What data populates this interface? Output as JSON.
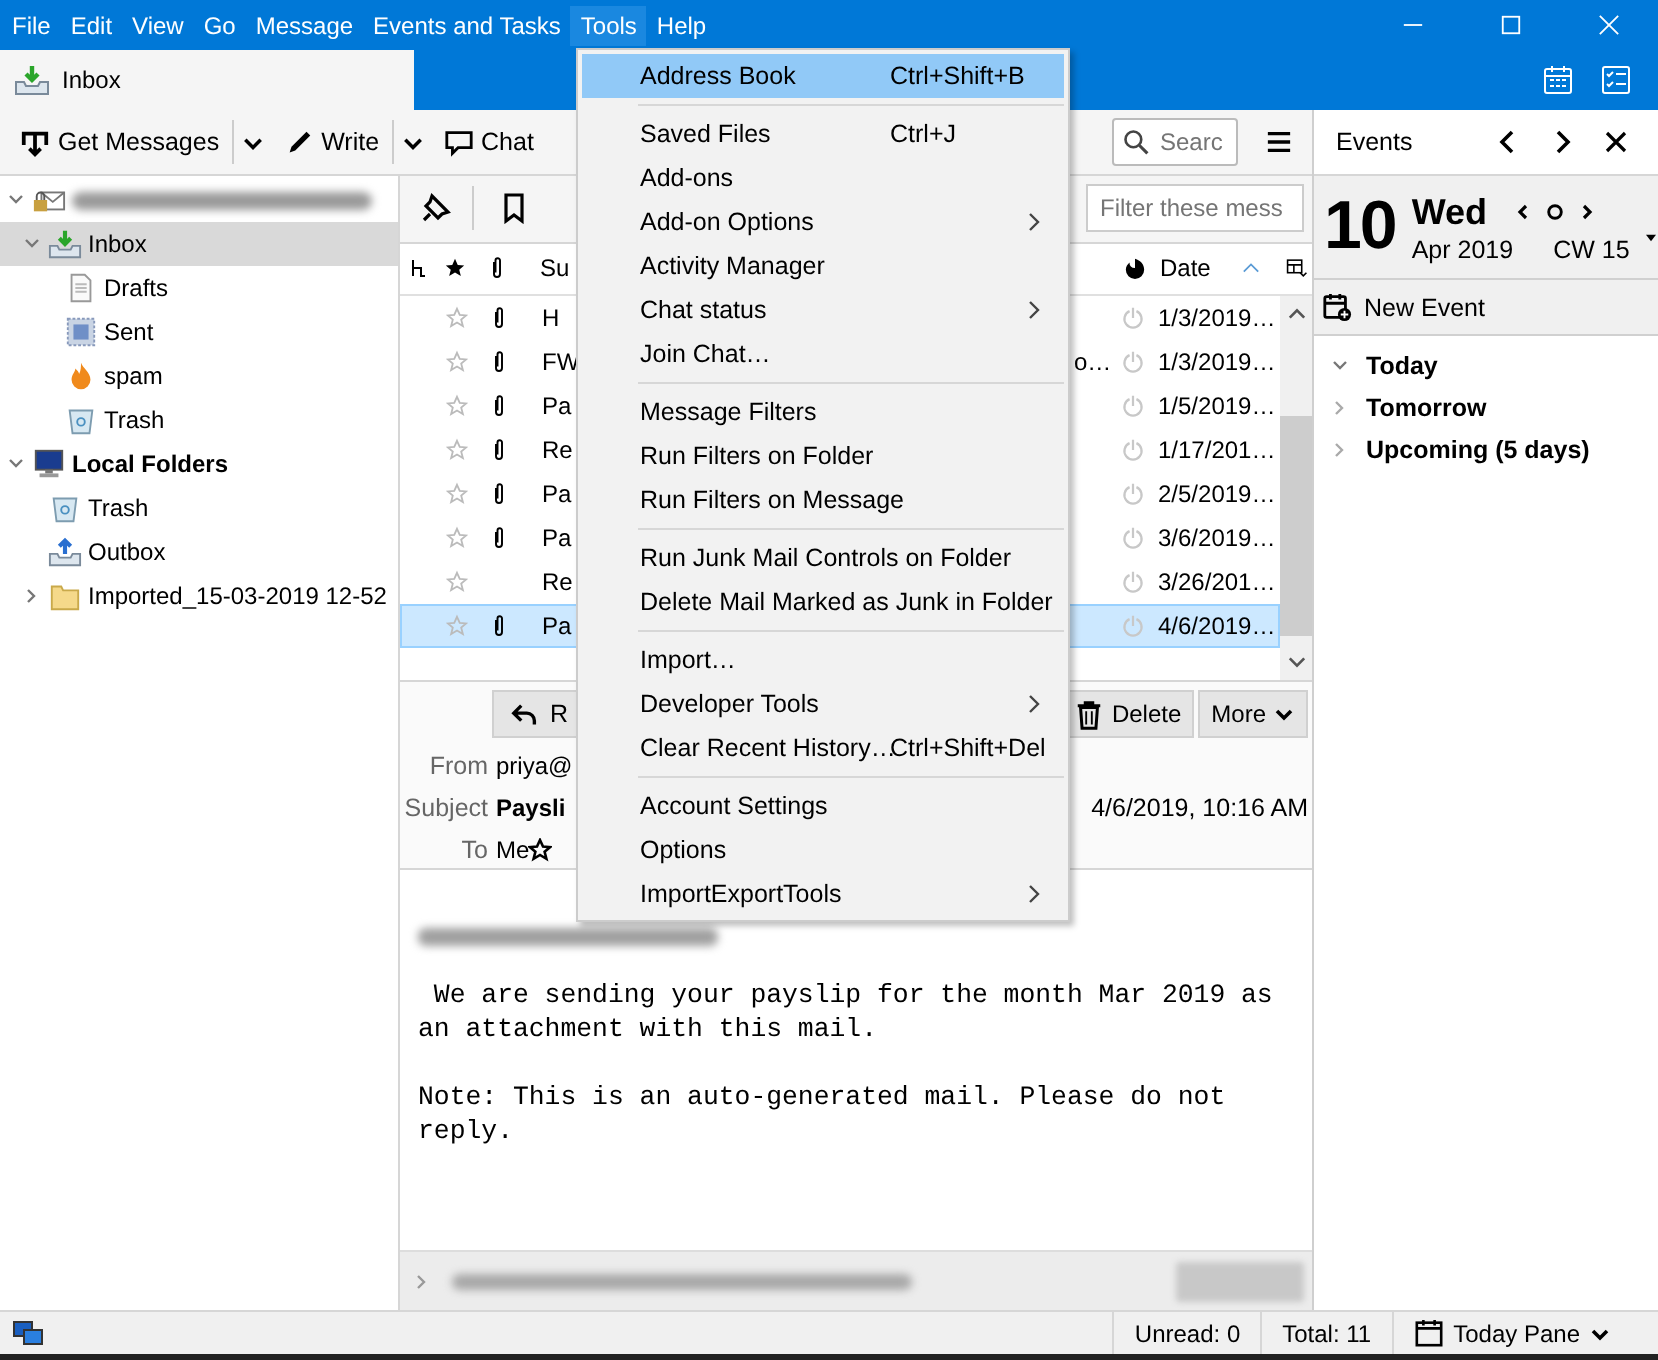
{
  "menubar": [
    {
      "label": "File",
      "selected": false
    },
    {
      "label": "Edit",
      "selected": false
    },
    {
      "label": "View",
      "selected": false
    },
    {
      "label": "Go",
      "selected": false
    },
    {
      "label": "Message",
      "selected": false
    },
    {
      "label": "Events and Tasks",
      "selected": false
    },
    {
      "label": "Tools",
      "selected": true
    },
    {
      "label": "Help",
      "selected": false
    }
  ],
  "tabs": [
    {
      "label": "Inbox",
      "selected": true
    }
  ],
  "toolbar": {
    "buttons": [
      {
        "kind": "get",
        "label": "Get Messages",
        "dropdown": true
      },
      {
        "kind": "write",
        "label": "Write",
        "dropdown": true
      },
      {
        "kind": "chat",
        "label": "Chat",
        "dropdown": false
      }
    ],
    "search": {
      "placeholder": "Searc"
    }
  },
  "folders": [
    {
      "kind": "account",
      "expanded": true,
      "selected": false,
      "children": [
        {
          "kind": "inbox",
          "label": "Inbox",
          "expanded": true,
          "selected": true,
          "children": [
            {
              "kind": "drafts",
              "label": "Drafts",
              "selected": false
            },
            {
              "kind": "sent",
              "label": "Sent",
              "selected": false
            },
            {
              "kind": "spam",
              "label": "spam",
              "selected": false
            },
            {
              "kind": "trash",
              "label": "Trash",
              "selected": false
            }
          ]
        }
      ]
    },
    {
      "kind": "local",
      "label": "Local Folders",
      "expanded": true,
      "selected": false,
      "children": [
        {
          "kind": "trash",
          "label": "Trash",
          "selected": false
        },
        {
          "kind": "outbox",
          "label": "Outbox",
          "selected": false
        },
        {
          "kind": "folder",
          "label": "Imported_15-03-2019 12-52",
          "expanded": false,
          "selected": false
        }
      ]
    }
  ],
  "quick_filter": {
    "placeholder": "Filter these mess"
  },
  "message_list": {
    "columns": {
      "subject": "Su",
      "date": "Date"
    },
    "rows": [
      {
        "starred": false,
        "attachment": true,
        "subject": "H",
        "date": "1/3/2019…",
        "selected": false
      },
      {
        "starred": false,
        "attachment": true,
        "subject": "FW",
        "column_4": "o…",
        "date": "1/3/2019…",
        "selected": false
      },
      {
        "starred": false,
        "attachment": true,
        "subject": "Pa",
        "date": "1/5/2019…",
        "selected": false
      },
      {
        "starred": false,
        "attachment": true,
        "subject": "Re",
        "date": "1/17/201…",
        "selected": false
      },
      {
        "starred": false,
        "attachment": true,
        "subject": "Pa",
        "date": "2/5/2019…",
        "selected": false
      },
      {
        "starred": false,
        "attachment": true,
        "subject": "Pa",
        "date": "3/6/2019…",
        "selected": false
      },
      {
        "starred": false,
        "attachment": false,
        "subject": "Re",
        "date": "3/26/201…",
        "selected": false
      },
      {
        "starred": false,
        "attachment": true,
        "subject": "Pa",
        "date": "4/6/2019…",
        "selected": true
      }
    ]
  },
  "message_header": {
    "buttons": [
      {
        "kind": "reply",
        "label": "R"
      },
      {
        "kind": "delete",
        "label": "Delete"
      },
      {
        "kind": "more",
        "label": "More"
      }
    ],
    "fields": [
      {
        "label": "From",
        "value": "priya@"
      },
      {
        "label": "Subject",
        "value": "Paysli",
        "date": "4/6/2019, 10:16 AM"
      },
      {
        "label": "To",
        "value": "Me"
      }
    ]
  },
  "body": {
    "paragraphs": [
      " We are sending your payslip for the month Mar 2019 as\nan attachment with this mail.",
      "Note: This is an auto-generated mail. Please do not\nreply."
    ]
  },
  "events": {
    "title": "Events",
    "day": "10",
    "weekday": "Wed",
    "month_year": "Apr 2019",
    "week": "CW 15",
    "new_event": "New Event",
    "sections": [
      {
        "label": "Today",
        "expanded": true
      },
      {
        "label": "Tomorrow",
        "expanded": false
      },
      {
        "label": "Upcoming (5 days)",
        "expanded": false
      }
    ]
  },
  "status_bar": {
    "unread": "Unread: 0",
    "total": "Total: 11",
    "today_pane": "Today Pane"
  },
  "tools_menu": {
    "items": [
      {
        "kind": "item",
        "label": "Address Book",
        "shortcut": "Ctrl+Shift+B",
        "submenu": false,
        "selected": true
      },
      {
        "kind": "separator"
      },
      {
        "kind": "item",
        "label": "Saved Files",
        "shortcut": "Ctrl+J",
        "submenu": false,
        "selected": false
      },
      {
        "kind": "item",
        "label": "Add-ons",
        "submenu": false,
        "selected": false
      },
      {
        "kind": "item",
        "label": "Add-on Options",
        "submenu": true,
        "selected": false
      },
      {
        "kind": "item",
        "label": "Activity Manager",
        "submenu": false,
        "selected": false
      },
      {
        "kind": "item",
        "label": "Chat status",
        "submenu": true,
        "selected": false
      },
      {
        "kind": "item",
        "label": "Join Chat…",
        "submenu": false,
        "selected": false
      },
      {
        "kind": "separator"
      },
      {
        "kind": "item",
        "label": "Message Filters",
        "submenu": false,
        "selected": false
      },
      {
        "kind": "item",
        "label": "Run Filters on Folder",
        "submenu": false,
        "selected": false
      },
      {
        "kind": "item",
        "label": "Run Filters on Message",
        "submenu": false,
        "selected": false
      },
      {
        "kind": "separator"
      },
      {
        "kind": "item",
        "label": "Run Junk Mail Controls on Folder",
        "submenu": false,
        "selected": false
      },
      {
        "kind": "item",
        "label": "Delete Mail Marked as Junk in Folder",
        "submenu": false,
        "selected": false
      },
      {
        "kind": "separator"
      },
      {
        "kind": "item",
        "label": "Import…",
        "submenu": false,
        "selected": false
      },
      {
        "kind": "item",
        "label": "Developer Tools",
        "submenu": true,
        "selected": false
      },
      {
        "kind": "item",
        "label": "Clear Recent History…",
        "shortcut": "Ctrl+Shift+Del",
        "submenu": false,
        "selected": false
      },
      {
        "kind": "separator"
      },
      {
        "kind": "item",
        "label": "Account Settings",
        "submenu": false,
        "selected": false
      },
      {
        "kind": "item",
        "label": "Options",
        "submenu": false,
        "selected": false
      },
      {
        "kind": "item",
        "label": "ImportExportTools",
        "submenu": true,
        "selected": false
      }
    ]
  }
}
